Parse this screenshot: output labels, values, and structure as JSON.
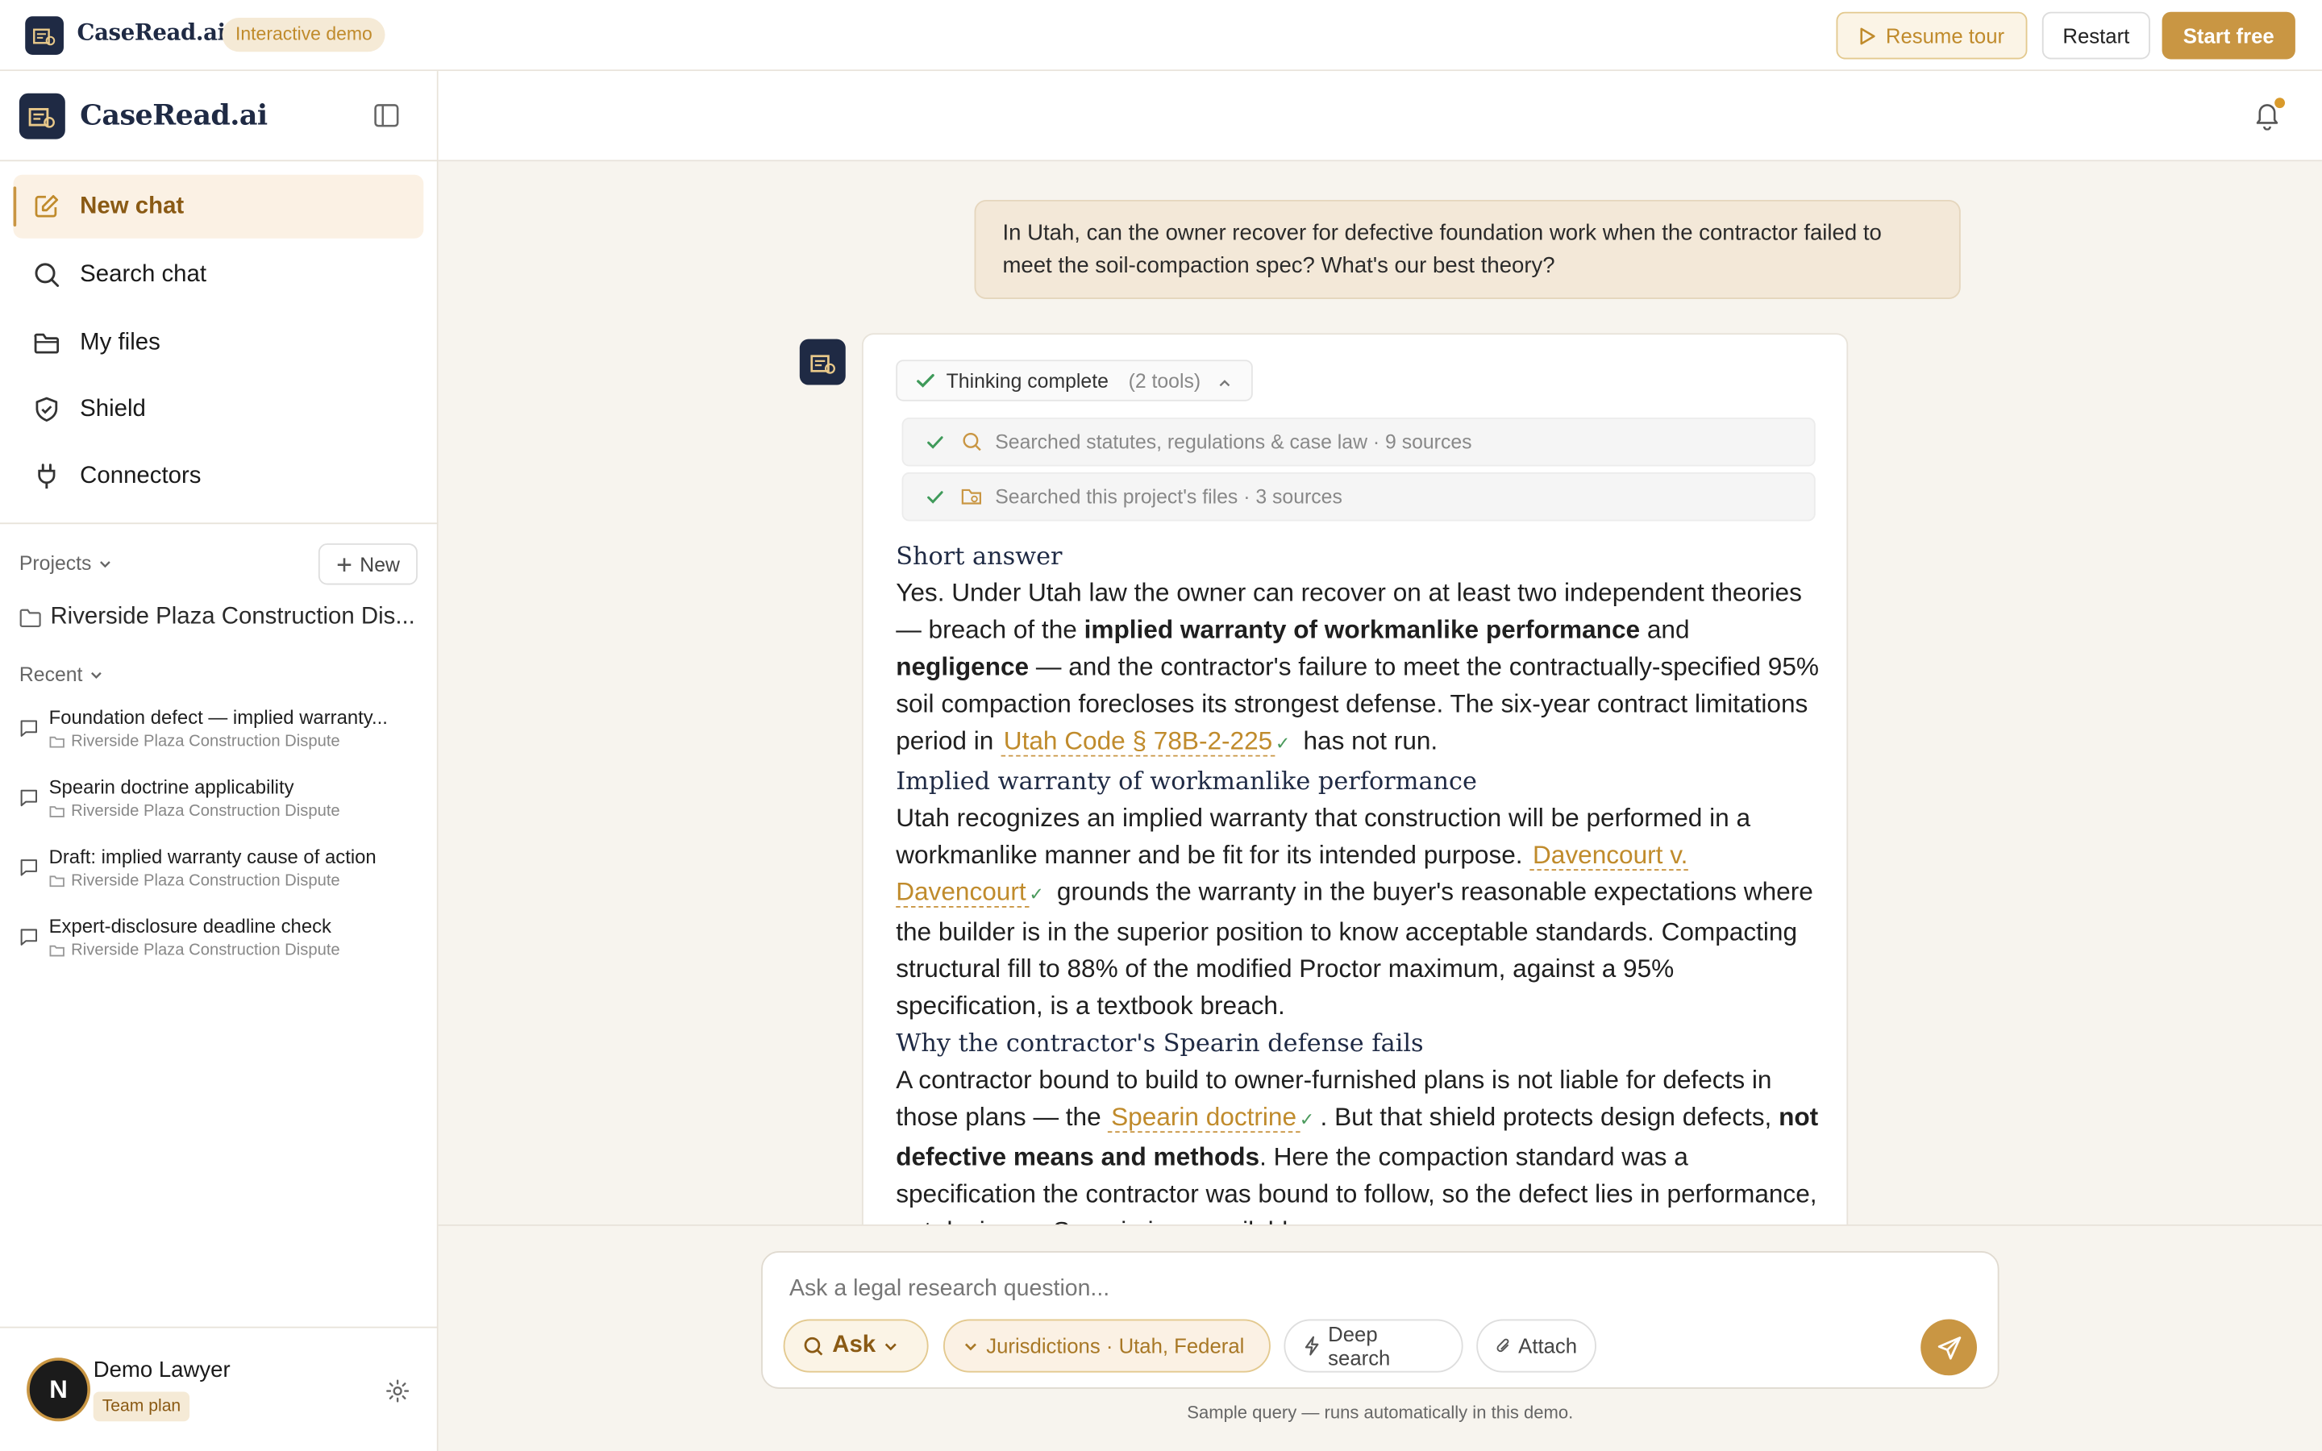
{
  "topbar": {
    "brand": "CaseRead.ai",
    "badge": "Interactive demo",
    "resume_label": "Resume tour",
    "restart_label": "Restart",
    "start_label": "Start free"
  },
  "sidebar": {
    "brand": "CaseRead.ai",
    "nav": [
      {
        "label": "New chat",
        "icon": "edit-icon"
      },
      {
        "label": "Search chat",
        "icon": "search-icon"
      },
      {
        "label": "My files",
        "icon": "folder-icon"
      },
      {
        "label": "Shield",
        "icon": "shield-icon"
      },
      {
        "label": "Connectors",
        "icon": "plug-icon"
      }
    ],
    "projects_label": "Projects",
    "new_label": "New",
    "project_name": "Riverside Plaza Construction Dis...",
    "recent_label": "Recent",
    "recent": [
      {
        "title": "Foundation defect — implied warranty...",
        "project": "Riverside Plaza Construction Dispute"
      },
      {
        "title": "Spearin doctrine applicability",
        "project": "Riverside Plaza Construction Dispute"
      },
      {
        "title": "Draft: implied warranty cause of action",
        "project": "Riverside Plaza Construction Dispute"
      },
      {
        "title": "Expert-disclosure deadline check",
        "project": "Riverside Plaza Construction Dispute"
      }
    ],
    "user": {
      "initial": "N",
      "name": "Demo Lawyer",
      "plan": "Team plan"
    }
  },
  "chat": {
    "user_message": "In Utah, can the owner recover for defective foundation work when the contractor failed to meet the soil-compaction spec? What's our best theory?",
    "thinking_label": "Thinking complete",
    "thinking_count": "(2 tools)",
    "tools": [
      "Searched statutes, regulations & case law · 9 sources",
      "Searched this project's files · 3 sources"
    ],
    "sections": {
      "short_heading": "Short answer",
      "s1_a": "Yes. Under Utah law the owner can recover on at least two independent theories — breach of the ",
      "s1_b1": "implied warranty of workmanlike performance",
      "s1_c": " and ",
      "s1_b2": "negligence",
      "s1_d": " — and the contractor's failure to meet the contractually-specified 95% soil compaction forecloses its strongest defense. The six-year contract limitations period in ",
      "s1_cite": "Utah Code § 78B-2-225",
      "s1_e": " has not run.",
      "warranty_heading": "Implied warranty of workmanlike performance",
      "s2_a": "Utah recognizes an implied warranty that construction will be performed in a workmanlike manner and be fit for its intended purpose. ",
      "s2_cite": "Davencourt v. Davencourt",
      "s2_b": " grounds the warranty in the buyer's reasonable expectations where the builder is in the superior position to know acceptable standards. Compacting structural fill to 88% of the modified Proctor maximum, against a 95% specification, is a textbook breach.",
      "spearin_heading": "Why the contractor's Spearin defense fails",
      "s3_a": "A contractor bound to build to owner-furnished plans is not liable for defects in those plans — the ",
      "s3_cite": "Spearin doctrine",
      "s3_b": ". But that shield protects design defects, ",
      "s3_b1": "not defective means and methods",
      "s3_c": ". Here the compaction standard was a specification the contractor was bound to follow, so the defect lies in performance, not design — Spearin is unavailable."
    }
  },
  "composer": {
    "placeholder": "Ask a legal research question...",
    "ask_label": "Ask",
    "jurisdictions_label": "Jurisdictions · Utah, Federal",
    "deep_label": "Deep search",
    "attach_label": "Attach",
    "footnote": "Sample query — runs automatically in this demo."
  }
}
